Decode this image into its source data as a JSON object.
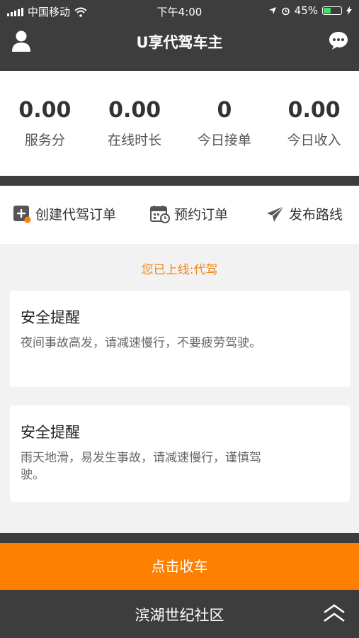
{
  "status_bar": {
    "carrier": "中国移动",
    "time": "下午4:00",
    "battery": "45%",
    "battery_level": 0.45
  },
  "header": {
    "title": "U享代驾车主",
    "left_icon": "user-icon",
    "right_icon": "chat-bubble-icon"
  },
  "stats": [
    {
      "value": "0.00",
      "label": "服务分"
    },
    {
      "value": "0.00",
      "label": "在线时长"
    },
    {
      "value": "0",
      "label": "今日接单"
    },
    {
      "value": "0.00",
      "label": "今日收入"
    }
  ],
  "actions": [
    {
      "label": "创建代驾订单",
      "icon": "create-order-icon"
    },
    {
      "label": "预约订单",
      "icon": "calendar-clock-icon"
    },
    {
      "label": "发布路线",
      "icon": "paper-plane-icon"
    }
  ],
  "online_status": "您已上线:代驾",
  "cards": [
    {
      "title": "安全提醒",
      "body": "夜间事故高发，请减速慢行，不要疲劳驾驶。"
    },
    {
      "title": "安全提醒",
      "body": "雨天地滑，易发生事故，请减速慢行，谨慎驾驶。"
    }
  ],
  "collect_button": "点击收车",
  "location": "滨湖世纪社区",
  "colors": {
    "dark_bar": "#3d3d3d",
    "accent_orange": "#ff7f00",
    "online_text": "#f08519",
    "battery_green": "#4cd964"
  }
}
